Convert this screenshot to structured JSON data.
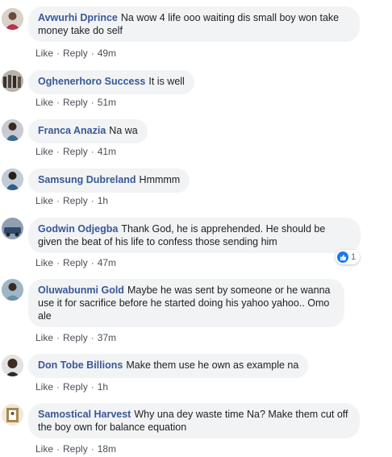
{
  "comments": [
    {
      "author": "Avwurhi Dprince",
      "text": "Na wow 4 life ooo waiting dis small boy won take money take do self",
      "like": "Like",
      "reply": "Reply",
      "time": "49m",
      "avatar_color": "#b8334a"
    },
    {
      "author": "Oghenerhoro Success",
      "text": "It is well",
      "like": "Like",
      "reply": "Reply",
      "time": "51m",
      "avatar_color": "#5a5148"
    },
    {
      "author": "Franca Anazia",
      "text": "Na wa",
      "like": "Like",
      "reply": "Reply",
      "time": "41m",
      "avatar_color": "#3a6a8a"
    },
    {
      "author": "Samsung Dubreland",
      "text": "Hmmmm",
      "like": "Like",
      "reply": "Reply",
      "time": "1h",
      "avatar_color": "#2d5f8c"
    },
    {
      "author": "Godwin Odjegba",
      "text": "Thank God, he is apprehended. He should be given the beat of his life to confess those sending him",
      "like": "Like",
      "reply": "Reply",
      "time": "47m",
      "avatar_color": "#2f4a6a",
      "reaction_count": "1"
    },
    {
      "author": "Oluwabunmi Gold",
      "text": "Maybe he was sent by someone or he wanna use it for sacrifice before he started doing his yahoo yahoo.. Omo ale",
      "like": "Like",
      "reply": "Reply",
      "time": "37m",
      "avatar_color": "#6b8fa8"
    },
    {
      "author": "Don Tobe Billions",
      "text": "Make them use he own as example na",
      "like": "Like",
      "reply": "Reply",
      "time": "1h",
      "avatar_color": "#3d2a20"
    },
    {
      "author": "Samostical Harvest",
      "text": "Why una dey waste time Na? Make them cut off the boy own for balance equation",
      "like": "Like",
      "reply": "Reply",
      "time": "18m",
      "avatar_color": "#a88a4a"
    }
  ],
  "colors": {
    "author": "#385898",
    "bubble": "#f2f3f5",
    "like_blue": "#1877f2"
  }
}
